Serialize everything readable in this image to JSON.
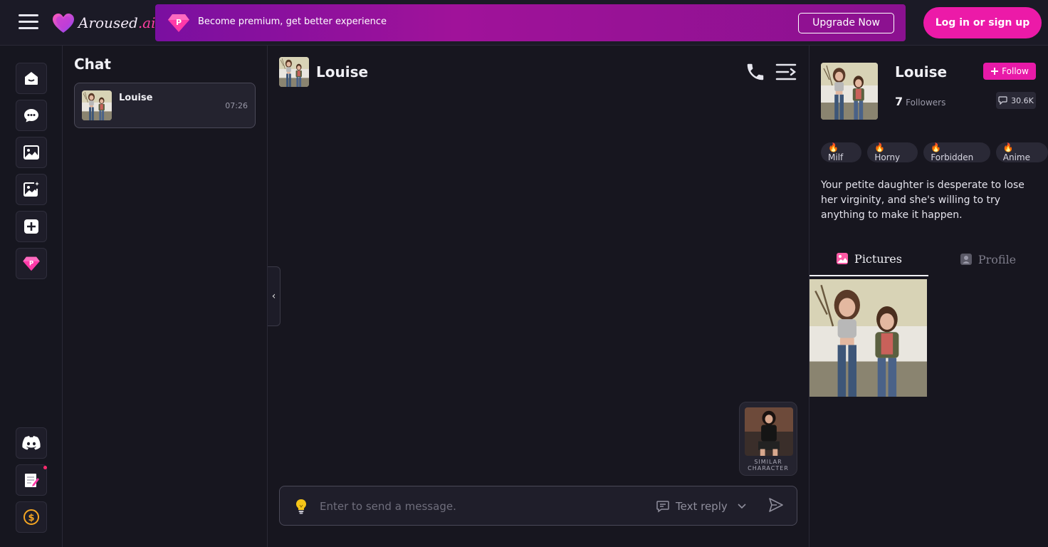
{
  "header": {
    "logo_text": "Aroused",
    "logo_suffix": ".ai",
    "promo_text": "Become premium, get better experience",
    "upgrade_label": "Upgrade Now",
    "login_label": "Log in or sign up"
  },
  "rail": {
    "items": [
      {
        "icon": "home-icon"
      },
      {
        "icon": "chat-icon"
      },
      {
        "icon": "gallery-icon"
      },
      {
        "icon": "generate-image-icon"
      },
      {
        "icon": "create-character-icon"
      },
      {
        "icon": "premium-gem-icon"
      },
      {
        "icon": "discord-icon"
      },
      {
        "icon": "notes-icon"
      },
      {
        "icon": "coin-icon"
      }
    ]
  },
  "chatlist": {
    "title": "Chat",
    "items": [
      {
        "name": "Louise",
        "time": "07:26"
      }
    ]
  },
  "conversation": {
    "name": "Louise",
    "similar_label": "SIMILAR CHARACTER",
    "input_placeholder": "Enter to send a message.",
    "reply_mode": "Text reply"
  },
  "profile": {
    "name": "Louise",
    "follow_label": "Follow",
    "followers_count": "7",
    "followers_label": "Followers",
    "messages_count": "30.6K",
    "tags": [
      "🔥 Milf",
      "🔥 Horny",
      "🔥 Forbidden",
      "🔥 Anime"
    ],
    "description": "Your petite daughter is desperate to lose her virginity, and she's willing to try anything to make it happen.",
    "tabs": {
      "pictures": "Pictures",
      "profile": "Profile"
    }
  },
  "colors": {
    "accent": "#ec1aa8",
    "background": "#16161f",
    "promo_gradient_start": "#7a0fa0",
    "promo_gradient_end": "#8b1190"
  }
}
